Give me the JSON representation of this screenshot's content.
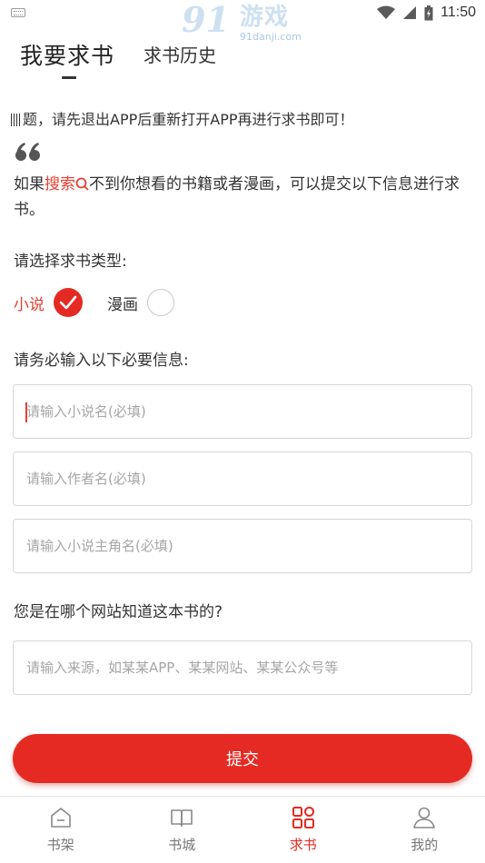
{
  "status_bar": {
    "time": "11:50",
    "watermark": {
      "number": "91",
      "name": "游戏",
      "domain": "91danji.com"
    },
    "icons": [
      "keyboard-icon",
      "wifi-icon",
      "signal-icon",
      "battery-icon"
    ]
  },
  "header": {
    "tabs": [
      {
        "label": "我要求书",
        "active": true
      },
      {
        "label": "求书历史",
        "active": false
      }
    ]
  },
  "notice": {
    "text": "题，请先退出APP后重新打开APP再进行求书即可！"
  },
  "intro": {
    "before": "如果",
    "link": "搜索",
    "after": "不到你想看的书籍或者漫画，可以提交以下信息进行求书。"
  },
  "type_section": {
    "label": "请选择求书类型:",
    "options": [
      {
        "label": "小说",
        "selected": true
      },
      {
        "label": "漫画",
        "selected": false
      }
    ]
  },
  "required_section": {
    "label": "请务必输入以下必要信息:",
    "fields": [
      {
        "placeholder": "请输入小说名(必填)",
        "value": ""
      },
      {
        "placeholder": "请输入作者名(必填)",
        "value": ""
      },
      {
        "placeholder": "请输入小说主角名(必填)",
        "value": ""
      }
    ]
  },
  "source_section": {
    "label": "您是在哪个网站知道这本书的?",
    "field": {
      "placeholder": "请输入来源，如某某APP、某某网站、某某公众号等",
      "value": ""
    }
  },
  "submit": {
    "label": "提交"
  },
  "bottom_nav": {
    "items": [
      {
        "label": "书架",
        "icon": "bookshelf-icon",
        "active": false
      },
      {
        "label": "书城",
        "icon": "book-icon",
        "active": false
      },
      {
        "label": "求书",
        "icon": "grid-icon",
        "active": true
      },
      {
        "label": "我的",
        "icon": "user-icon",
        "active": false
      }
    ]
  },
  "colors": {
    "accent": "#e42a22",
    "link": "#e53f33",
    "text": "#333333",
    "placeholder": "#a6a6a6",
    "border": "#d6d6d6"
  }
}
